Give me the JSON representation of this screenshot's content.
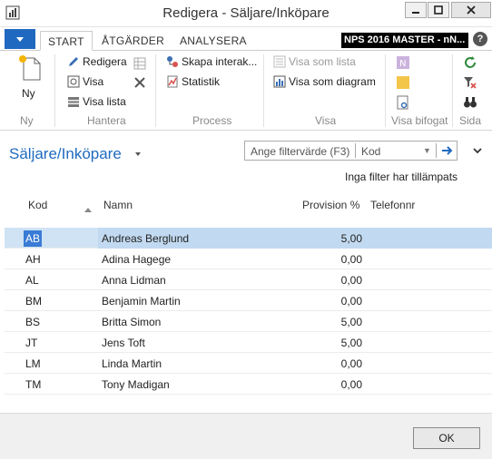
{
  "window": {
    "title": "Redigera - Säljare/Inköpare",
    "colors": {
      "accent": "#1f6ac0",
      "selection": "#cfe3f4"
    }
  },
  "tabs": [
    {
      "label": "START"
    },
    {
      "label": "ÅTGÄRDER"
    },
    {
      "label": "ANALYSERA"
    }
  ],
  "company": "NPS 2016 MASTER - nN...",
  "ribbon": {
    "new_label": "Ny",
    "edit_label": "Redigera",
    "view_label": "Visa",
    "view_list_label": "Visa lista",
    "create_interaction_label": "Skapa interak...",
    "statistics_label": "Statistik",
    "show_as_list_label": "Visa som lista",
    "show_as_chart_label": "Visa som diagram",
    "groups": {
      "new": "Ny",
      "manage": "Hantera",
      "process": "Process",
      "view": "Visa",
      "attachments": "Visa bifogat",
      "page": "Sida"
    }
  },
  "page": {
    "title": "Säljare/Inköpare",
    "filter_placeholder": "Ange filtervärde (F3)",
    "filter_field": "Kod",
    "no_filter_text": "Inga filter har tillämpats"
  },
  "table": {
    "columns": {
      "kod": "Kod",
      "namn": "Namn",
      "provision": "Provision %",
      "telefon": "Telefonnr"
    },
    "rows": [
      {
        "kod": "AB",
        "namn": "Andreas Berglund",
        "provision": "5,00"
      },
      {
        "kod": "AH",
        "namn": "Adina Hagege",
        "provision": "0,00"
      },
      {
        "kod": "AL",
        "namn": "Anna Lidman",
        "provision": "0,00"
      },
      {
        "kod": "BM",
        "namn": "Benjamin Martin",
        "provision": "0,00"
      },
      {
        "kod": "BS",
        "namn": "Britta Simon",
        "provision": "5,00"
      },
      {
        "kod": "JT",
        "namn": "Jens Toft",
        "provision": "5,00"
      },
      {
        "kod": "LM",
        "namn": "Linda Martin",
        "provision": "0,00"
      },
      {
        "kod": "TM",
        "namn": "Tony Madigan",
        "provision": "0,00"
      }
    ]
  },
  "footer": {
    "ok_label": "OK"
  }
}
